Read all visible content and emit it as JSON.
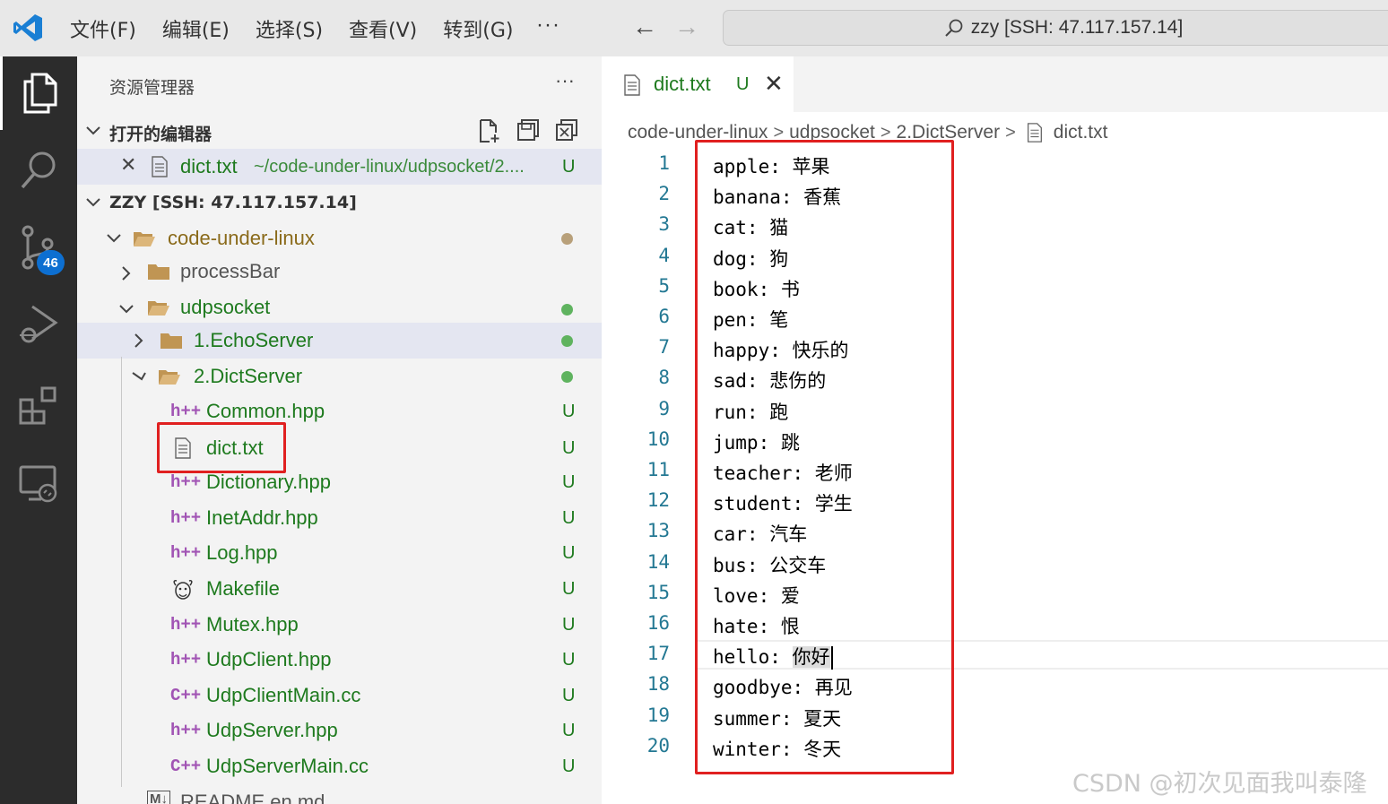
{
  "titlebar": {
    "menu": [
      "文件(F)",
      "编辑(E)",
      "选择(S)",
      "查看(V)",
      "转到(G)"
    ],
    "more": "···",
    "search_text": "zzy [SSH: 47.117.157.14]"
  },
  "activitybar": {
    "scm_badge": "46"
  },
  "sidebar": {
    "title": "资源管理器",
    "more": "···",
    "open_editors": {
      "title": "打开的编辑器",
      "item_name": "dict.txt",
      "item_path": "~/code-under-linux/udpsocket/2....",
      "item_status": "U"
    },
    "workspace": {
      "title": "ZZY [SSH: 47.117.157.14]",
      "root": "code-under-linux",
      "processbar": "processBar",
      "udpsocket": "udpsocket",
      "echoserver": "1.EchoServer",
      "dictserver": "2.DictServer",
      "files": [
        {
          "name": "Common.hpp",
          "status": "U"
        },
        {
          "name": "dict.txt",
          "status": "U"
        },
        {
          "name": "Dictionary.hpp",
          "status": "U"
        },
        {
          "name": "InetAddr.hpp",
          "status": "U"
        },
        {
          "name": "Log.hpp",
          "status": "U"
        },
        {
          "name": "Makefile",
          "status": "U"
        },
        {
          "name": "Mutex.hpp",
          "status": "U"
        },
        {
          "name": "UdpClient.hpp",
          "status": "U"
        },
        {
          "name": "UdpClientMain.cc",
          "status": "U"
        },
        {
          "name": "UdpServer.hpp",
          "status": "U"
        },
        {
          "name": "UdpServerMain.cc",
          "status": "U"
        }
      ],
      "readme": "README.en.md"
    }
  },
  "editor": {
    "tab": {
      "name": "dict.txt",
      "status": "U"
    },
    "breadcrumb": [
      "code-under-linux",
      "udpsocket",
      "2.DictServer",
      "dict.txt"
    ],
    "lines": [
      {
        "num": "1",
        "text": "apple: 苹果"
      },
      {
        "num": "2",
        "text": "banana: 香蕉"
      },
      {
        "num": "3",
        "text": "cat: 猫"
      },
      {
        "num": "4",
        "text": "dog: 狗"
      },
      {
        "num": "5",
        "text": "book: 书"
      },
      {
        "num": "6",
        "text": "pen: 笔"
      },
      {
        "num": "7",
        "text": "happy: 快乐的"
      },
      {
        "num": "8",
        "text": "sad: 悲伤的"
      },
      {
        "num": "9",
        "text": "run: 跑"
      },
      {
        "num": "10",
        "text": "jump: 跳"
      },
      {
        "num": "11",
        "text": "teacher: 老师"
      },
      {
        "num": "12",
        "text": "student: 学生"
      },
      {
        "num": "13",
        "text": "car: 汽车"
      },
      {
        "num": "14",
        "text": "bus: 公交车"
      },
      {
        "num": "15",
        "text": "love: 爱"
      },
      {
        "num": "16",
        "text": "hate: 恨"
      },
      {
        "num": "17",
        "text_prefix": "hello: ",
        "text_selected": "你好"
      },
      {
        "num": "18",
        "text": "goodbye: 再见"
      },
      {
        "num": "19",
        "text": "summer: 夏天"
      },
      {
        "num": "20",
        "text": "winter: 冬天"
      }
    ]
  },
  "watermark": "CSDN @初次见面我叫泰隆",
  "colors": {
    "activitybar": "#2c2c2c",
    "sidebar": "#f3f3f3",
    "git_untracked": "#1e7a1e",
    "line_number": "#237893",
    "highlight_box": "#e02020",
    "badge": "#0d6fd1"
  }
}
